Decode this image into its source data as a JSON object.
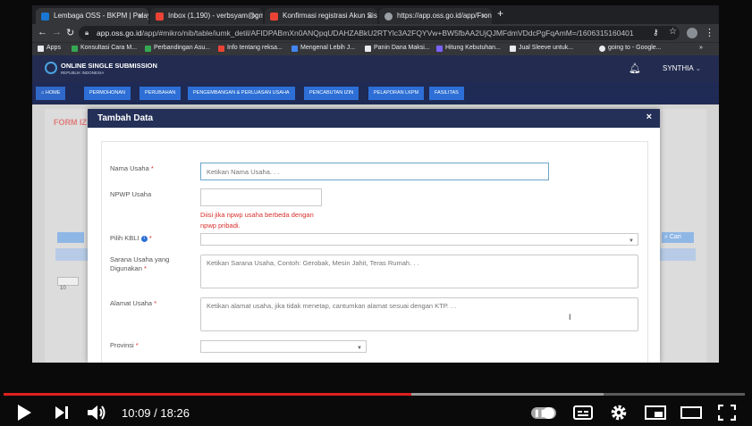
{
  "browser": {
    "tabs": [
      {
        "title": "Lembaga OSS - BKPM | Pelaya",
        "color": "#1976d2",
        "active": true
      },
      {
        "title": "Inbox (1,190) - verbsyam@gm",
        "color": "#ea4335",
        "active": false
      },
      {
        "title": "Konfirmasi registrasi Akun Sis",
        "color": "#ea4335",
        "active": false
      },
      {
        "title": "https://app.oss.go.id/app/Fron",
        "color": "#9aa0a6",
        "active": false
      }
    ],
    "new_tab_glyph": "+",
    "url_host": "app.oss.go.id",
    "url_path": "/app/#mikro/nib/table/iumk_detil/AFIDPABmXn0ANQpqUDAHZABkU2RTYlc3A2FQYVw+BW5fbAA2UjQJMFdmVDdcPgFqAmM=/1606315160401",
    "bookmarks": [
      {
        "label": "Apps",
        "color": "#e8eaed"
      },
      {
        "label": "Konsultasi Cara M...",
        "color": "#34a853"
      },
      {
        "label": "Perbandingan Asu...",
        "color": "#34a853"
      },
      {
        "label": "Info tentang reksa...",
        "color": "#ea4335"
      },
      {
        "label": "Mengenal Lebih J...",
        "color": "#4285f4"
      },
      {
        "label": "Panin Dana Maksi...",
        "color": "#e8eaed"
      },
      {
        "label": "Hitung Kebutuhan...",
        "color": "#7b61ff"
      },
      {
        "label": "Jual Sleeve untuk...",
        "color": "#e8eaed"
      },
      {
        "label": "going to - Google...",
        "color": "#e8eaed"
      }
    ],
    "more_glyph": "»"
  },
  "site": {
    "logo_title": "ONLINE SINGLE SUBMISSION",
    "logo_sub": "REPUBLIK INDONESIA",
    "user": "SYNTHIA",
    "menu": [
      "HOME",
      "PERMOHONAN",
      "PERUBAHAN",
      "PENGEMBANGAN & PERLUASAN USAHA",
      "PENCABUTAN IZIN",
      "PELAPORAN LKPM",
      "FASILITAS"
    ],
    "bg_title": "FORM IZ",
    "bg_search": "Cari",
    "bg_page_size": "10"
  },
  "modal": {
    "title": "Tambah Data",
    "close": "×",
    "fields": {
      "nama_usaha_label": "Nama Usaha",
      "nama_usaha_placeholder": "Ketikan Nama Usaha. . .",
      "npwp_label": "NPWP Usaha",
      "npwp_hint_1": "Diisi jika npwp usaha berbeda dengan",
      "npwp_hint_2": "npwp pribadi.",
      "kbli_label": "Pilih KBLI",
      "sarana_label_1": "Sarana Usaha yang",
      "sarana_label_2": "Digunakan",
      "sarana_placeholder": "Ketikan Sarana Usaha, Contoh: Gerobak, Mesin Jahit, Teras Rumah. . .",
      "alamat_label": "Alamat Usaha",
      "alamat_placeholder": "Ketikan alamat usaha, jika tidak menetap, cantumkan alamat sesuai dengan KTP. . .",
      "provinsi_label": "Provinsi"
    },
    "required_mark": "*"
  },
  "player": {
    "current_time": "10:09",
    "separator": " / ",
    "duration": "18:26",
    "progress_fraction": 0.5505,
    "buffered_fraction": 0.8095
  },
  "colors": {
    "accent_red": "#e02020",
    "nav_blue": "#2d6fd6",
    "header_navy": "#243057"
  }
}
